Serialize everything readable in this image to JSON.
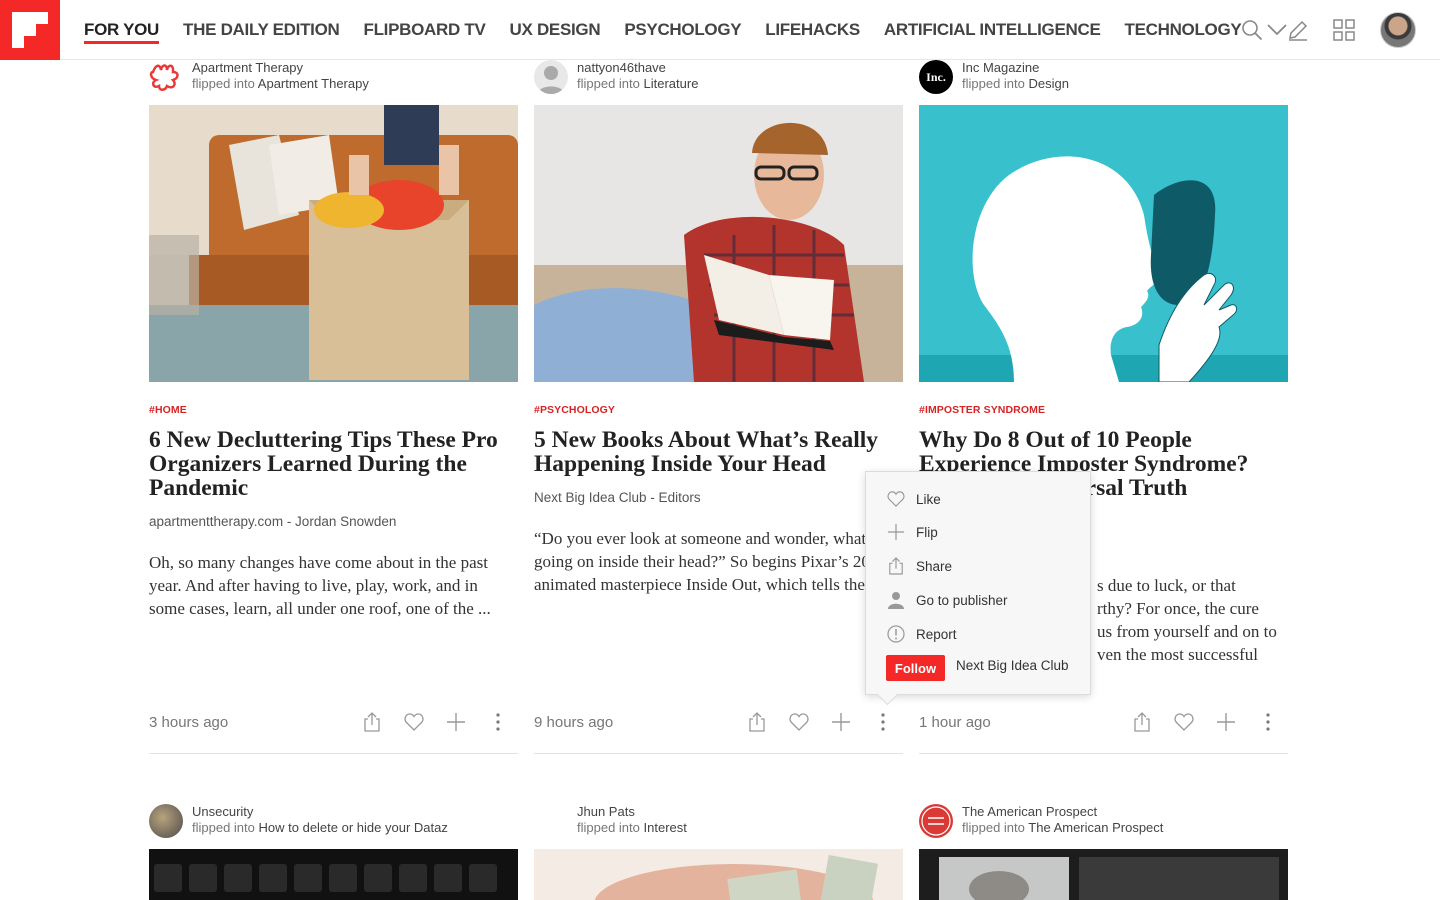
{
  "nav": {
    "tabs": [
      {
        "label": "FOR YOU",
        "active": true
      },
      {
        "label": "THE DAILY EDITION"
      },
      {
        "label": "FLIPBOARD TV"
      },
      {
        "label": "UX DESIGN"
      },
      {
        "label": "PSYCHOLOGY"
      },
      {
        "label": "LIFEHACKS"
      },
      {
        "label": "ARTIFICIAL INTELLIGENCE"
      },
      {
        "label": "TECHNOLOGY"
      }
    ],
    "more_icon": "chevron-down-icon",
    "right_icons": [
      "search-icon",
      "pencil-icon",
      "grid-icon"
    ],
    "brand_color": "#f52828"
  },
  "cards": [
    {
      "source": "Apartment Therapy",
      "flipped_prefix": "flipped into",
      "flipped_into": "Apartment Therapy",
      "tag": "#HOME",
      "title": "6 New Decluttering Tips These Pro Organizers Learned During the Pandemic",
      "byline": "apartmenttherapy.com - Jordan Snowden",
      "excerpt": "Oh, so many changes have come about in the past year. And after having to live, play, work, and in some cases, learn, all under one roof, one of the ...",
      "time": "3 hours ago"
    },
    {
      "source": "nattyon46thave",
      "flipped_prefix": "flipped into",
      "flipped_into": "Literature",
      "tag": "#PSYCHOLOGY",
      "title": "5 New Books About What’s Really Happening Inside Your Head",
      "byline": "Next Big Idea Club - Editors",
      "excerpt": "“Do you ever look at someone and wonder, what is going on inside their head?” So begins Pixar’s 2015 animated masterpiece Inside Out, which tells the ...",
      "time": "9 hours ago"
    },
    {
      "source": "Inc Magazine",
      "source_logo_text": "Inc.",
      "flipped_prefix": "flipped into",
      "flipped_into": "Design",
      "tag": "#IMPOSTER SYNDROME",
      "title": "Why Do 8 Out of 10 People Experience Imposter Syndrome? Here's the Universal Truth",
      "excerpt_lines": [
        "s due to luck, or that",
        "rthy? For once, the cure",
        "us from yourself and on to",
        "ven the most successful"
      ],
      "time": "1 hour ago"
    }
  ],
  "row2": [
    {
      "source": "Unsecurity",
      "flipped_prefix": "flipped into",
      "flipped_into": "How to delete or hide your Dataz"
    },
    {
      "source": "Jhun Pats",
      "flipped_prefix": "flipped into",
      "flipped_into": "Interest"
    },
    {
      "source": "The American Prospect",
      "flipped_prefix": "flipped into",
      "flipped_into": "The American Prospect"
    }
  ],
  "menu": {
    "items": [
      {
        "label": "Like",
        "icon": "heart-icon"
      },
      {
        "label": "Flip",
        "icon": "plus-icon"
      },
      {
        "label": "Share",
        "icon": "share-icon"
      },
      {
        "label": "Go to publisher",
        "icon": "person-icon"
      },
      {
        "label": "Report",
        "icon": "alert-icon"
      }
    ],
    "follow_label": "Follow",
    "follow_name": "Next Big Idea Club"
  },
  "footer_icons": [
    "share-icon",
    "heart-icon",
    "plus-icon",
    "more-vertical-icon"
  ]
}
